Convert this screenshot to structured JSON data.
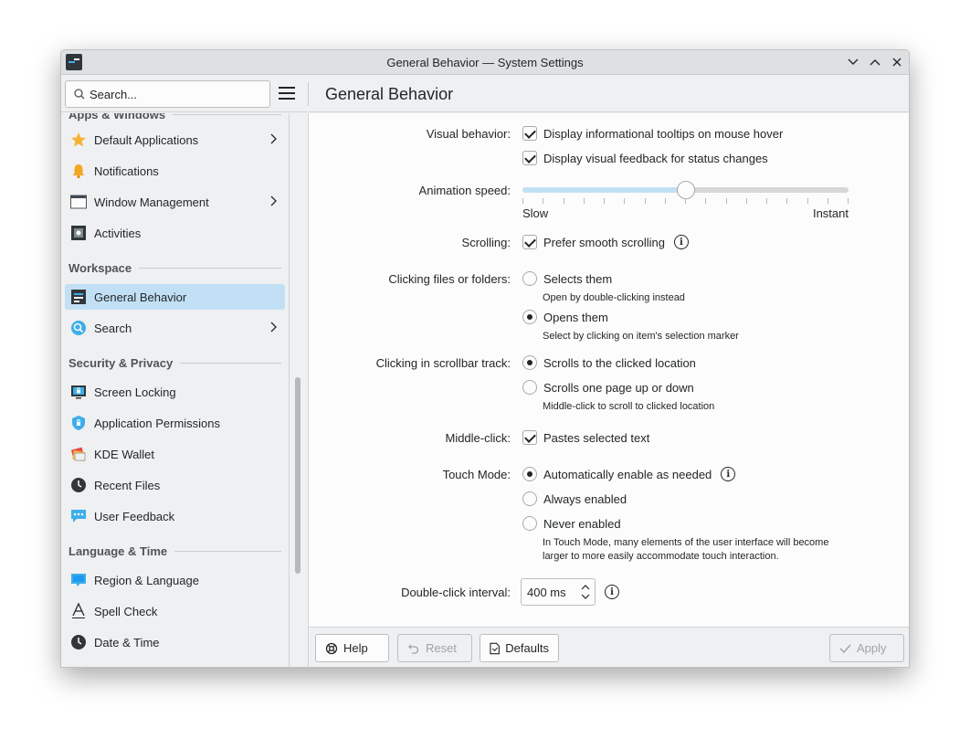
{
  "window": {
    "title": "General Behavior — System Settings"
  },
  "search": {
    "placeholder": "Search..."
  },
  "page": {
    "title": "General Behavior"
  },
  "sidebar": {
    "partial_header": "Apps & Windows",
    "items": [
      {
        "label": "Default Applications",
        "icon": "star-icon",
        "chevron": true
      },
      {
        "label": "Notifications",
        "icon": "bell-icon",
        "chevron": false
      },
      {
        "label": "Window Management",
        "icon": "window-icon",
        "chevron": true
      },
      {
        "label": "Activities",
        "icon": "activities-icon",
        "chevron": false
      }
    ],
    "workspace_header": "Workspace",
    "workspace_items": [
      {
        "label": "General Behavior",
        "icon": "general-behavior-icon",
        "chevron": false,
        "selected": true
      },
      {
        "label": "Search",
        "icon": "search-globe-icon",
        "chevron": true
      }
    ],
    "security_header": "Security & Privacy",
    "security_items": [
      {
        "label": "Screen Locking",
        "icon": "screen-lock-icon"
      },
      {
        "label": "Application Permissions",
        "icon": "shield-icon"
      },
      {
        "label": "KDE Wallet",
        "icon": "wallet-icon"
      },
      {
        "label": "Recent Files",
        "icon": "clock-icon"
      },
      {
        "label": "User Feedback",
        "icon": "feedback-icon"
      }
    ],
    "language_header": "Language & Time",
    "language_items": [
      {
        "label": "Region & Language",
        "icon": "region-icon"
      },
      {
        "label": "Spell Check",
        "icon": "spellcheck-icon"
      },
      {
        "label": "Date & Time",
        "icon": "clock-icon"
      }
    ]
  },
  "settings": {
    "visual_behavior": {
      "label": "Visual behavior:",
      "tooltips": {
        "label": "Display informational tooltips on mouse hover",
        "checked": true
      },
      "feedback": {
        "label": "Display visual feedback for status changes",
        "checked": true
      }
    },
    "animation_speed": {
      "label": "Animation speed:",
      "min_label": "Slow",
      "max_label": "Instant",
      "value_fraction": 0.5,
      "ticks": 17
    },
    "scrolling": {
      "label": "Scrolling:",
      "smooth": {
        "label": "Prefer smooth scrolling",
        "checked": true
      }
    },
    "clicking_files": {
      "label": "Clicking files or folders:",
      "selects": {
        "label": "Selects them",
        "sub": "Open by double-clicking instead",
        "checked": false
      },
      "opens": {
        "label": "Opens them",
        "sub": "Select by clicking on item's selection marker",
        "checked": true
      }
    },
    "scrollbar_track": {
      "label": "Clicking in scrollbar track:",
      "scroll_to": {
        "label": "Scrolls to the clicked location",
        "checked": true
      },
      "page": {
        "label": "Scrolls one page up or down",
        "sub": "Middle-click to scroll to clicked location",
        "checked": false
      }
    },
    "middle_click": {
      "label": "Middle-click:",
      "paste": {
        "label": "Pastes selected text",
        "checked": true
      }
    },
    "touch_mode": {
      "label": "Touch Mode:",
      "auto": {
        "label": "Automatically enable as needed",
        "checked": true
      },
      "always": {
        "label": "Always enabled",
        "checked": false
      },
      "never": {
        "label": "Never enabled",
        "checked": false
      },
      "note_line1": "In Touch Mode, many elements of the user interface will become",
      "note_line2": "larger to more easily accommodate touch interaction."
    },
    "double_click": {
      "label": "Double-click interval:",
      "value": "400 ms"
    }
  },
  "footer": {
    "help": "Help",
    "reset": "Reset",
    "defaults": "Defaults",
    "apply": "Apply"
  },
  "colors": {
    "accent": "#3daee9",
    "selection": "#c2e0f5"
  }
}
